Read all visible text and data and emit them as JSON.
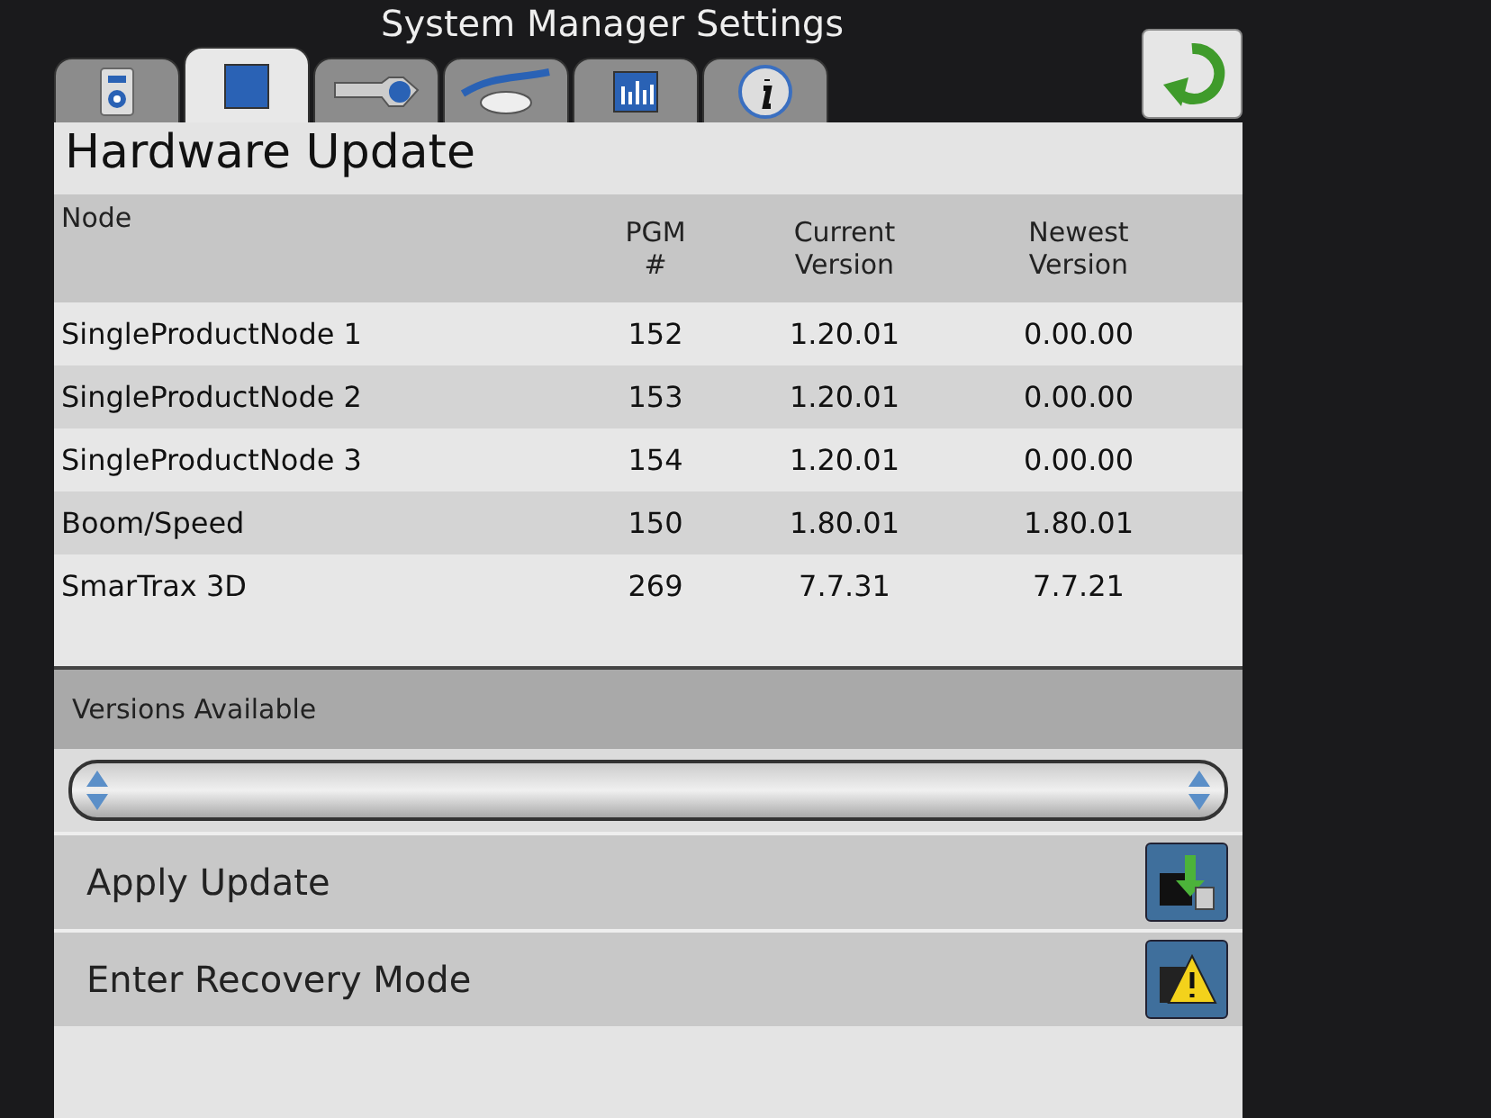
{
  "window": {
    "title": "System Manager Settings"
  },
  "tabs": [
    {
      "kind": "device",
      "selected": false
    },
    {
      "kind": "square",
      "selected": true
    },
    {
      "kind": "key",
      "selected": false
    },
    {
      "kind": "wand",
      "selected": false
    },
    {
      "kind": "chart",
      "selected": false
    },
    {
      "kind": "info",
      "selected": false
    }
  ],
  "page_title": "Hardware Update",
  "table": {
    "columns": [
      "Node",
      "PGM\n#",
      "Current\nVersion",
      "Newest\nVersion"
    ],
    "rows": [
      [
        "SingleProductNode 1",
        "152",
        "1.20.01",
        "0.00.00"
      ],
      [
        "SingleProductNode 2",
        "153",
        "1.20.01",
        "0.00.00"
      ],
      [
        "SingleProductNode 3",
        "154",
        "1.20.01",
        "0.00.00"
      ],
      [
        "Boom/Speed",
        "150",
        "1.80.01",
        "1.80.01"
      ],
      [
        "SmarTrax 3D",
        "269",
        "7.7.31",
        "7.7.21"
      ]
    ]
  },
  "versions": {
    "label": "Versions Available"
  },
  "actions": [
    {
      "label": "Apply Update",
      "kind": "download"
    },
    {
      "label": "Enter Recovery Mode",
      "kind": "warning"
    }
  ]
}
